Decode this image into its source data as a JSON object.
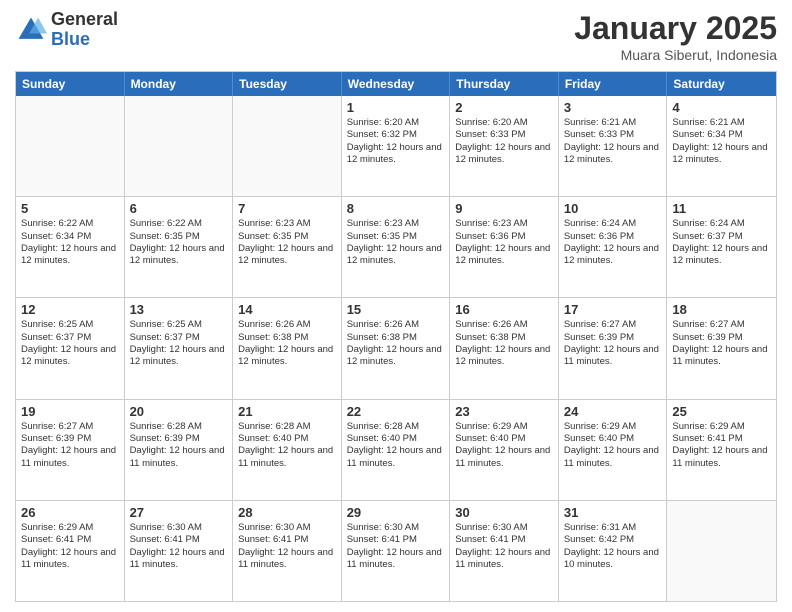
{
  "header": {
    "logo_general": "General",
    "logo_blue": "Blue",
    "month_year": "January 2025",
    "location": "Muara Siberut, Indonesia"
  },
  "days_of_week": [
    "Sunday",
    "Monday",
    "Tuesday",
    "Wednesday",
    "Thursday",
    "Friday",
    "Saturday"
  ],
  "weeks": [
    [
      {
        "day": "",
        "info": "",
        "empty": true
      },
      {
        "day": "",
        "info": "",
        "empty": true
      },
      {
        "day": "",
        "info": "",
        "empty": true
      },
      {
        "day": "1",
        "info": "Sunrise: 6:20 AM\nSunset: 6:32 PM\nDaylight: 12 hours and 12 minutes."
      },
      {
        "day": "2",
        "info": "Sunrise: 6:20 AM\nSunset: 6:33 PM\nDaylight: 12 hours and 12 minutes."
      },
      {
        "day": "3",
        "info": "Sunrise: 6:21 AM\nSunset: 6:33 PM\nDaylight: 12 hours and 12 minutes."
      },
      {
        "day": "4",
        "info": "Sunrise: 6:21 AM\nSunset: 6:34 PM\nDaylight: 12 hours and 12 minutes."
      }
    ],
    [
      {
        "day": "5",
        "info": "Sunrise: 6:22 AM\nSunset: 6:34 PM\nDaylight: 12 hours and 12 minutes."
      },
      {
        "day": "6",
        "info": "Sunrise: 6:22 AM\nSunset: 6:35 PM\nDaylight: 12 hours and 12 minutes."
      },
      {
        "day": "7",
        "info": "Sunrise: 6:23 AM\nSunset: 6:35 PM\nDaylight: 12 hours and 12 minutes."
      },
      {
        "day": "8",
        "info": "Sunrise: 6:23 AM\nSunset: 6:35 PM\nDaylight: 12 hours and 12 minutes."
      },
      {
        "day": "9",
        "info": "Sunrise: 6:23 AM\nSunset: 6:36 PM\nDaylight: 12 hours and 12 minutes."
      },
      {
        "day": "10",
        "info": "Sunrise: 6:24 AM\nSunset: 6:36 PM\nDaylight: 12 hours and 12 minutes."
      },
      {
        "day": "11",
        "info": "Sunrise: 6:24 AM\nSunset: 6:37 PM\nDaylight: 12 hours and 12 minutes."
      }
    ],
    [
      {
        "day": "12",
        "info": "Sunrise: 6:25 AM\nSunset: 6:37 PM\nDaylight: 12 hours and 12 minutes."
      },
      {
        "day": "13",
        "info": "Sunrise: 6:25 AM\nSunset: 6:37 PM\nDaylight: 12 hours and 12 minutes."
      },
      {
        "day": "14",
        "info": "Sunrise: 6:26 AM\nSunset: 6:38 PM\nDaylight: 12 hours and 12 minutes."
      },
      {
        "day": "15",
        "info": "Sunrise: 6:26 AM\nSunset: 6:38 PM\nDaylight: 12 hours and 12 minutes."
      },
      {
        "day": "16",
        "info": "Sunrise: 6:26 AM\nSunset: 6:38 PM\nDaylight: 12 hours and 12 minutes."
      },
      {
        "day": "17",
        "info": "Sunrise: 6:27 AM\nSunset: 6:39 PM\nDaylight: 12 hours and 11 minutes."
      },
      {
        "day": "18",
        "info": "Sunrise: 6:27 AM\nSunset: 6:39 PM\nDaylight: 12 hours and 11 minutes."
      }
    ],
    [
      {
        "day": "19",
        "info": "Sunrise: 6:27 AM\nSunset: 6:39 PM\nDaylight: 12 hours and 11 minutes."
      },
      {
        "day": "20",
        "info": "Sunrise: 6:28 AM\nSunset: 6:39 PM\nDaylight: 12 hours and 11 minutes."
      },
      {
        "day": "21",
        "info": "Sunrise: 6:28 AM\nSunset: 6:40 PM\nDaylight: 12 hours and 11 minutes."
      },
      {
        "day": "22",
        "info": "Sunrise: 6:28 AM\nSunset: 6:40 PM\nDaylight: 12 hours and 11 minutes."
      },
      {
        "day": "23",
        "info": "Sunrise: 6:29 AM\nSunset: 6:40 PM\nDaylight: 12 hours and 11 minutes."
      },
      {
        "day": "24",
        "info": "Sunrise: 6:29 AM\nSunset: 6:40 PM\nDaylight: 12 hours and 11 minutes."
      },
      {
        "day": "25",
        "info": "Sunrise: 6:29 AM\nSunset: 6:41 PM\nDaylight: 12 hours and 11 minutes."
      }
    ],
    [
      {
        "day": "26",
        "info": "Sunrise: 6:29 AM\nSunset: 6:41 PM\nDaylight: 12 hours and 11 minutes."
      },
      {
        "day": "27",
        "info": "Sunrise: 6:30 AM\nSunset: 6:41 PM\nDaylight: 12 hours and 11 minutes."
      },
      {
        "day": "28",
        "info": "Sunrise: 6:30 AM\nSunset: 6:41 PM\nDaylight: 12 hours and 11 minutes."
      },
      {
        "day": "29",
        "info": "Sunrise: 6:30 AM\nSunset: 6:41 PM\nDaylight: 12 hours and 11 minutes."
      },
      {
        "day": "30",
        "info": "Sunrise: 6:30 AM\nSunset: 6:41 PM\nDaylight: 12 hours and 11 minutes."
      },
      {
        "day": "31",
        "info": "Sunrise: 6:31 AM\nSunset: 6:42 PM\nDaylight: 12 hours and 10 minutes."
      },
      {
        "day": "",
        "info": "",
        "empty": true
      }
    ]
  ]
}
